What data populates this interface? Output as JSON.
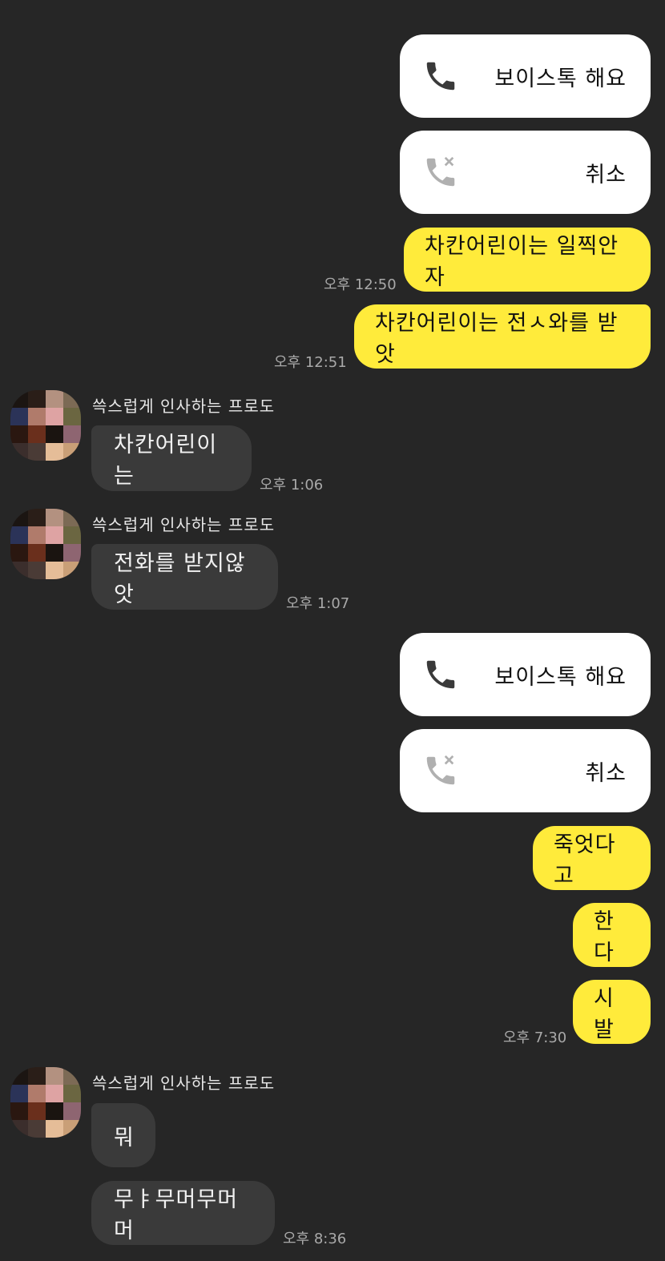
{
  "sender_name": "쓱스럽게 인사하는 프로도",
  "colors": {
    "background": "#262626",
    "my_bubble": "#ffeb3b",
    "their_bubble": "#3a3a3a",
    "call_card": "#ffffff",
    "avatar_pixels": [
      "#1b1512",
      "#2a1e18",
      "#b39180",
      "#7c6a55",
      "#2b3358",
      "#b07b6b",
      "#dea3a3",
      "#6b6641",
      "#2a1710",
      "#6a2f1c",
      "#1a1410",
      "#8e6571",
      "#3b2e2c",
      "#4a3b36",
      "#e5bd98",
      "#c99f77"
    ]
  },
  "messages": {
    "call1": {
      "label": "보이스톡 해요",
      "icon": "phone-icon"
    },
    "call2": {
      "label": "취소",
      "icon": "phone-cancelled-icon"
    },
    "m1": {
      "text": "차칸어린이는 일찍안자",
      "time": "오후 12:50"
    },
    "m2": {
      "text": "차칸어린이는 전ㅅ와를 받앗",
      "time": "오후 12:51"
    },
    "t1": {
      "text": "차칸어린이는",
      "time": "오후 1:06"
    },
    "t2": {
      "text": "전화를 받지않앗",
      "time": "오후 1:07"
    },
    "call3": {
      "label": "보이스톡 해요",
      "icon": "phone-icon"
    },
    "call4": {
      "label": "취소",
      "icon": "phone-cancelled-icon"
    },
    "m3": {
      "text": "죽엇다고"
    },
    "m4": {
      "text": "한다"
    },
    "m5": {
      "text": "시발",
      "time": "오후 7:30"
    },
    "t3": {
      "text": "뭐"
    },
    "t4": {
      "text": "무ㅑ무머무머머",
      "time": "오후 8:36"
    }
  }
}
